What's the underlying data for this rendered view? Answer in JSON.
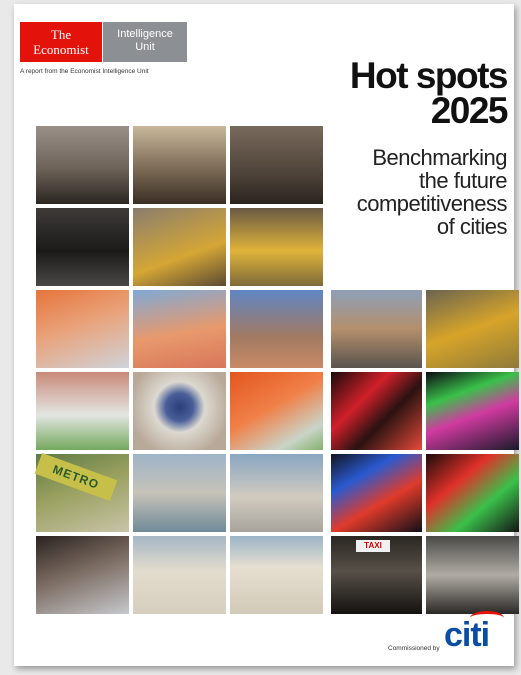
{
  "logo": {
    "economist_line1": "The",
    "economist_line2": "Economist",
    "eiu_line1": "Intelligence",
    "eiu_line2": "Unit",
    "brand_red": "#e3120b",
    "brand_grey": "#8c8f93"
  },
  "report_line": "A report from the Economist Intelligence Unit",
  "title": {
    "line1": "Hot spots",
    "line2": "2025"
  },
  "subtitle": {
    "line1": "Benchmarking",
    "line2": "the future",
    "line3": "competitiveness",
    "line4": "of cities"
  },
  "photo_signs": {
    "metro": "METRO",
    "taxi": "TAXI"
  },
  "footer": {
    "commissioned_by": "Commissioned by",
    "sponsor": "citi",
    "sponsor_color": "#0a4da2"
  }
}
